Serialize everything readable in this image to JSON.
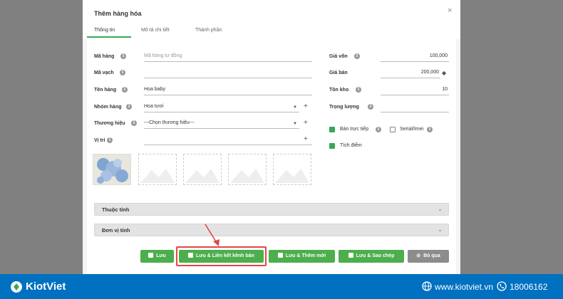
{
  "dialog": {
    "title": "Thêm hàng hóa",
    "close": "×",
    "tabs": [
      "Thông tin",
      "Mô tả chi tiết",
      "Thành phần"
    ]
  },
  "left_form": {
    "ma_hang": {
      "label": "Mã hàng",
      "placeholder": "Mã hàng tự động"
    },
    "ma_vach": {
      "label": "Mã vạch",
      "value": ""
    },
    "ten_hang": {
      "label": "Tên hàng",
      "value": "Hoa baby"
    },
    "nhom_hang": {
      "label": "Nhóm hàng",
      "value": "Hoa tươi"
    },
    "thuong_hieu": {
      "label": "Thương hiệu",
      "value": "---Chọn thương hiệu---"
    },
    "vi_tri": {
      "label": "Vị trí",
      "value": ""
    }
  },
  "right_form": {
    "gia_von": {
      "label": "Giá vốn",
      "value": "100,000"
    },
    "gia_ban": {
      "label": "Giá bán",
      "value": "200,000"
    },
    "ton_kho": {
      "label": "Tồn kho",
      "value": "10"
    },
    "trong_luong": {
      "label": "Trọng lượng",
      "value": ""
    },
    "ban_truc_tiep": {
      "label": "Bán trực tiếp",
      "checked": true
    },
    "serial_imei": {
      "label": "Serial/Imei",
      "checked": false
    },
    "tich_diem": {
      "label": "Tích điểm",
      "checked": true
    }
  },
  "sections": {
    "thuoc_tinh": "Thuộc tính",
    "don_vi_tinh": "Đơn vị tính"
  },
  "buttons": {
    "luu": "Lưu",
    "luu_lien_ket": "Lưu & Liên kết kênh bán",
    "luu_them_moi": "Lưu & Thêm mới",
    "luu_sao_chep": "Lưu & Sao chép",
    "bo_qua": "Bỏ qua"
  },
  "footer": {
    "brand": "KiotViet",
    "website": "www.kiotviet.vn",
    "phone": "18006162"
  },
  "colors": {
    "accent_green": "#4cae4c",
    "footer_blue": "#0070c0",
    "highlight_red": "#e04848"
  }
}
